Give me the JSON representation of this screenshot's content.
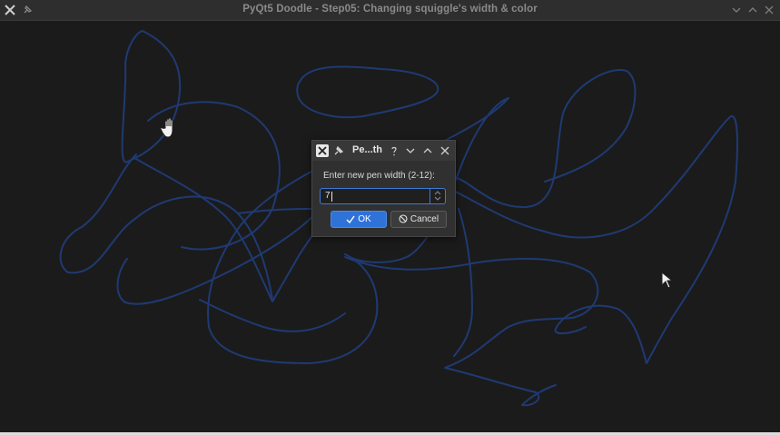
{
  "window": {
    "title": "PyQt5 Doodle - Step05: Changing squiggle's width & color",
    "icon": "app-logo-icon",
    "pin_icon": "pin-icon",
    "controls": [
      "minimize-icon",
      "maximize-icon",
      "close-icon"
    ]
  },
  "dialog": {
    "title": "Pe...th",
    "prompt": "Enter new pen width (2-12):",
    "value": "7",
    "ok_label": "OK",
    "cancel_label": "Cancel",
    "title_icons": [
      "app-logo-icon",
      "pin-icon",
      "help-icon",
      "minimize-icon",
      "maximize-icon",
      "close-icon"
    ]
  },
  "colors": {
    "canvas_background": "#1b1b1b",
    "stroke": "#1f3a73",
    "accent": "#2f72d8"
  },
  "cursors": [
    "hand-cursor-icon",
    "arrow-cursor-icon"
  ]
}
